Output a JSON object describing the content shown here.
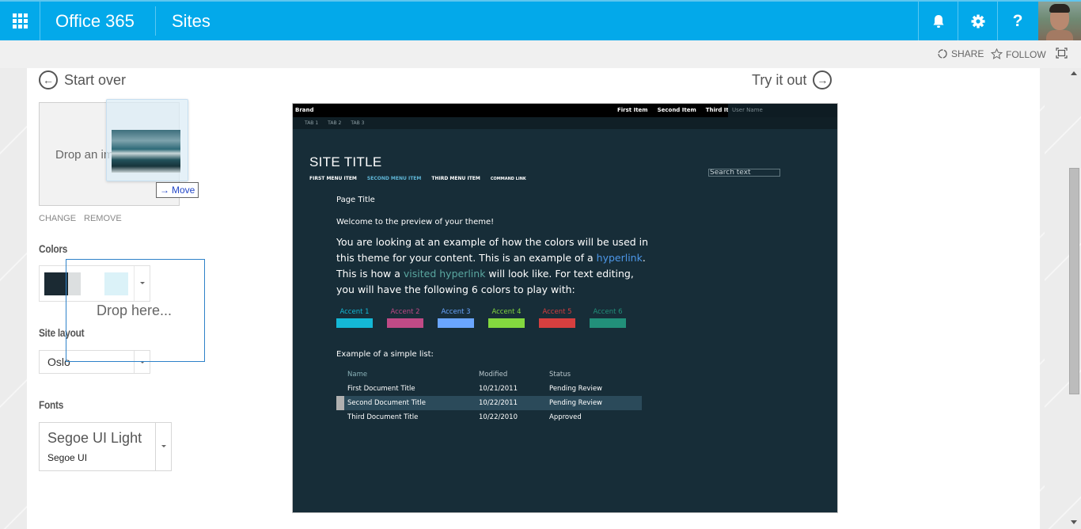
{
  "suite_bar": {
    "brand": "Office 365",
    "app_title": "Sites",
    "icons": [
      "app-launcher-icon",
      "bell-icon",
      "gear-icon",
      "help-icon"
    ],
    "help_glyph": "?"
  },
  "action_bar": {
    "share_label": "SHARE",
    "follow_label": "FOLLOW"
  },
  "nav": {
    "start_over": "Start over",
    "try_it_out": "Try it out"
  },
  "image_picker": {
    "drop_label": "Drop an image here",
    "drag_tooltip": "Move",
    "change_label": "CHANGE",
    "remove_label": "REMOVE"
  },
  "colors": {
    "heading": "Colors",
    "swatches": [
      "#1b2a33",
      "#dcdfe0",
      "#ffffff",
      "#dbf2f8"
    ],
    "drop_overlay": "Drop here..."
  },
  "site_layout": {
    "heading": "Site layout",
    "selected": "Oslo"
  },
  "fonts": {
    "heading": "Fonts",
    "heading_font": "Segoe UI Light",
    "body_font": "Segoe UI"
  },
  "preview": {
    "brand": "Brand",
    "top_nav": [
      "First Item",
      "Second Item",
      "Third Item"
    ],
    "user_name": "User Name",
    "tabs": [
      "TAB 1",
      "TAB 2",
      "TAB 3"
    ],
    "site_title": "SITE TITLE",
    "menu": [
      "FIRST MENU ITEM",
      "SECOND MENU ITEM",
      "THIRD MENU ITEM",
      "COMMAND LINK"
    ],
    "search_text": "Search text",
    "page_title": "Page Title",
    "welcome": "Welcome to the preview of your theme!",
    "body": {
      "part1": "You are looking at an example of how the colors will be used in this theme for your content. This is an example of a ",
      "hyperlink": "hyperlink",
      "part2": ". This is how a ",
      "visited_hyperlink": "visited hyperlink",
      "part3": " will look like. For text editing, you will have the following 6 colors to play with:"
    },
    "accents": [
      {
        "label": "Accent 1",
        "color": "#14b8d6"
      },
      {
        "label": "Accent 2",
        "color": "#c04a86"
      },
      {
        "label": "Accent 3",
        "color": "#6aa6ff"
      },
      {
        "label": "Accent 4",
        "color": "#83d83f"
      },
      {
        "label": "Accent 5",
        "color": "#d63f3f"
      },
      {
        "label": "Accent 6",
        "color": "#22907a"
      }
    ],
    "list_label": "Example of a simple list:",
    "table": {
      "columns": [
        "Name",
        "Modified",
        "Status"
      ],
      "rows": [
        [
          "First Document Title",
          "10/21/2011",
          "Pending Review"
        ],
        [
          "Second Document Title",
          "10/22/2011",
          "Pending Review"
        ],
        [
          "Third Document Title",
          "10/22/2010",
          "Approved"
        ]
      ],
      "selected_row": 1
    }
  }
}
